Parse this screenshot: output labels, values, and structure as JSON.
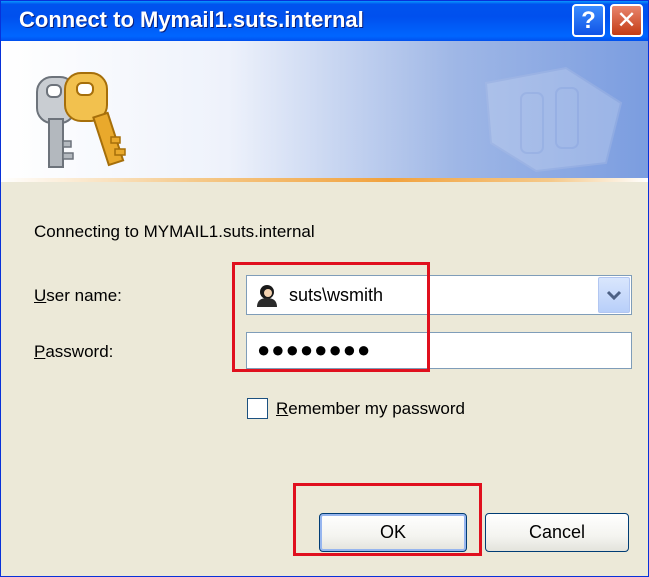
{
  "window": {
    "title": "Connect to Mymail1.suts.internal",
    "help_glyph": "?",
    "close_glyph": "✕"
  },
  "banner": {
    "icon": "keys-icon",
    "watermark_icon": "keys-watermark-icon"
  },
  "connecting_text": "Connecting to MYMAIL1.suts.internal",
  "user": {
    "label_accel": "U",
    "label_rest": "ser name:",
    "value": "suts\\wsmith",
    "icon": "user-avatar-icon"
  },
  "password": {
    "label_accel": "P",
    "label_rest": "assword:",
    "masked_value": "●●●●●●●●"
  },
  "remember": {
    "label_accel": "R",
    "label_rest": "emember my password",
    "checked": false
  },
  "buttons": {
    "ok": "OK",
    "cancel": "Cancel"
  },
  "colors": {
    "titlebar": "#0053ee",
    "highlight": "#e0101e",
    "dialog_bg": "#ece9d8"
  }
}
